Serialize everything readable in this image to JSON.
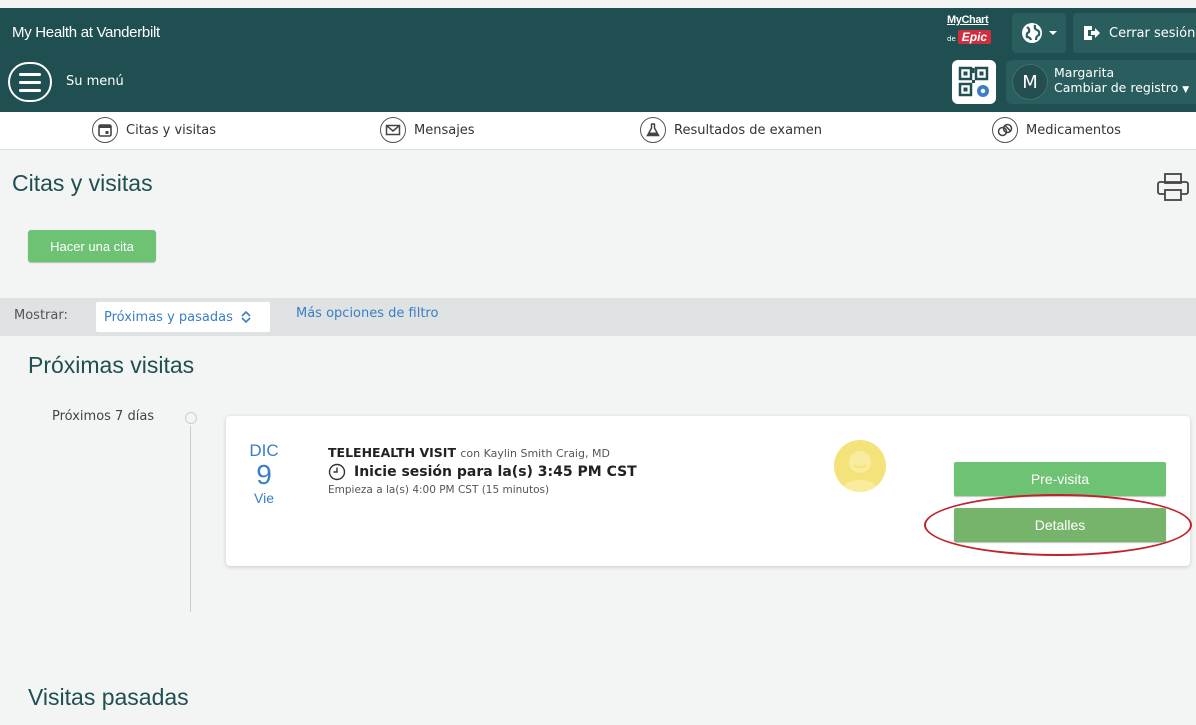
{
  "header": {
    "brand": "My Health at Vanderbilt",
    "mychart_logo": {
      "line1": "MyChart",
      "de": "de",
      "epic": "Epic"
    },
    "language_icon": "globe-icon",
    "logout_label": "Cerrar sesión",
    "menu_label": "Su menú",
    "user": {
      "initial": "M",
      "name": "Margarita",
      "switch_label": "Cambiar de registro"
    }
  },
  "activities": [
    {
      "label": "Citas y visitas",
      "icon": "calendar-icon"
    },
    {
      "label": "Mensajes",
      "icon": "envelope-icon"
    },
    {
      "label": "Resultados de examen",
      "icon": "flask-icon"
    },
    {
      "label": "Medicamentos",
      "icon": "pill-icon"
    }
  ],
  "page": {
    "title": "Citas y visitas",
    "schedule_button": "Hacer una cita",
    "filter": {
      "label": "Mostrar:",
      "selected": "Próximas y pasadas",
      "more_link": "Más opciones de filtro"
    },
    "upcoming": {
      "title": "Próximas visitas",
      "timeline_label": "Próximos 7 días",
      "visit": {
        "month": "DIC",
        "day": "9",
        "weekday": "Vie",
        "type": "TELEHEALTH VISIT",
        "with": "con Kaylin Smith Craig, MD",
        "checkin": "Inicie sesión para la(s) 3:45 PM CST",
        "starts": "Empieza a la(s) 4:00 PM CST (15 minutos)",
        "previsit_button": "Pre-visita",
        "details_button": "Detalles"
      }
    },
    "past": {
      "title": "Visitas pasadas"
    }
  },
  "colors": {
    "header": "#1f4f50",
    "accent_green": "#6dc274",
    "link_blue": "#3a7ec7",
    "annotation_red": "#c0232b"
  }
}
